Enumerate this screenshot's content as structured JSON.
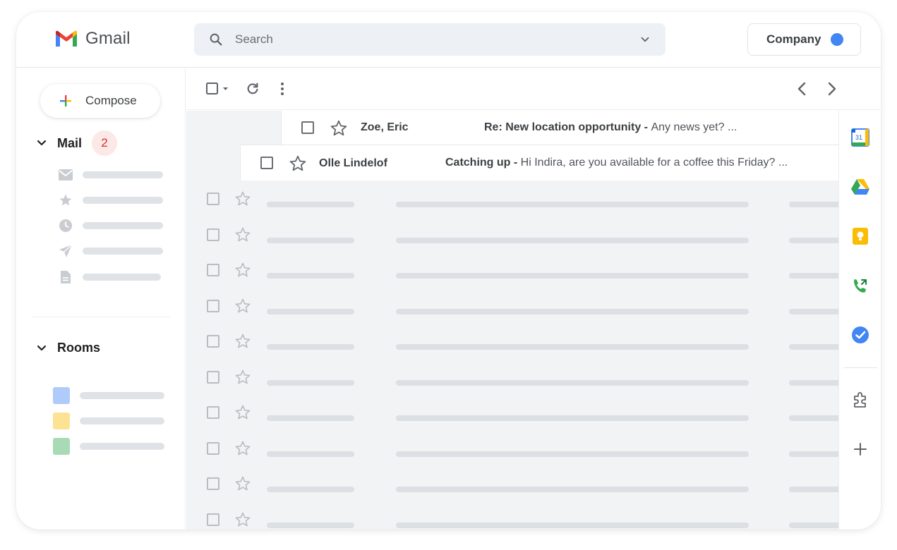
{
  "app": {
    "name": "Gmail"
  },
  "search": {
    "placeholder": "Search"
  },
  "account": {
    "label": "Company",
    "status_color": "#4285f4"
  },
  "compose": {
    "label": "Compose"
  },
  "sidebar": {
    "mail": {
      "label": "Mail",
      "badge": "2"
    },
    "mail_items": [
      "inbox-icon",
      "star-icon",
      "clock-icon",
      "send-icon",
      "draft-icon"
    ],
    "rooms": {
      "label": "Rooms"
    },
    "room_colors": [
      "#aecbfa",
      "#fde293",
      "#a8dab5"
    ]
  },
  "toolbar": {
    "icons": [
      "select-checkbox",
      "refresh-icon",
      "more-icon",
      "prev-page-icon",
      "next-page-icon"
    ]
  },
  "emails": [
    {
      "sender": "Zoe, Eric",
      "subject": "Re: New location opportunity -",
      "snippet": "Any news yet? ..."
    },
    {
      "sender": "Olle Lindelof",
      "subject": "Catching up -",
      "snippet": "Hi Indira, are you available for a coffee this Friday? ..."
    }
  ],
  "right_rail": {
    "icons": [
      "calendar-icon",
      "drive-icon",
      "keep-icon",
      "voice-icon",
      "tasks-icon",
      "addons-icon",
      "add-icon"
    ],
    "calendar_day": "31"
  },
  "colors": {
    "accent_red": "#d93025",
    "badge_bg": "#fce8e6",
    "search_bg": "#edf1f5"
  }
}
